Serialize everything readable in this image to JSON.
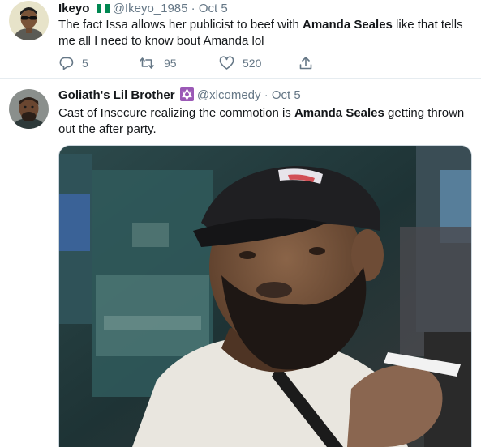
{
  "tweets": [
    {
      "name": "Ikeyo",
      "handle": "@Ikeyo_1985",
      "separator": "·",
      "date": "Oct 5",
      "text_parts": [
        "The fact Issa allows her publicist to beef with ",
        "Amanda Seales",
        " like that tells me all I need to know bout Amanda lol"
      ],
      "replies": "5",
      "retweets": "95",
      "likes": "520"
    },
    {
      "name": "Goliath's Lil Brother",
      "handle": "@xlcomedy",
      "separator": "·",
      "date": "Oct 5",
      "text_parts": [
        "Cast of Insecure realizing the commotion is ",
        "Amanda Seales",
        " getting thrown out the after party."
      ]
    }
  ],
  "colors": {
    "text": "#14171a",
    "muted": "#657786",
    "divider": "#e6ecf0",
    "star": "#9b59b6",
    "flag_green": "#008751"
  },
  "icons": [
    "reply-icon",
    "retweet-icon",
    "like-icon",
    "share-icon",
    "nigeria-flag-icon",
    "star-of-david-icon"
  ]
}
